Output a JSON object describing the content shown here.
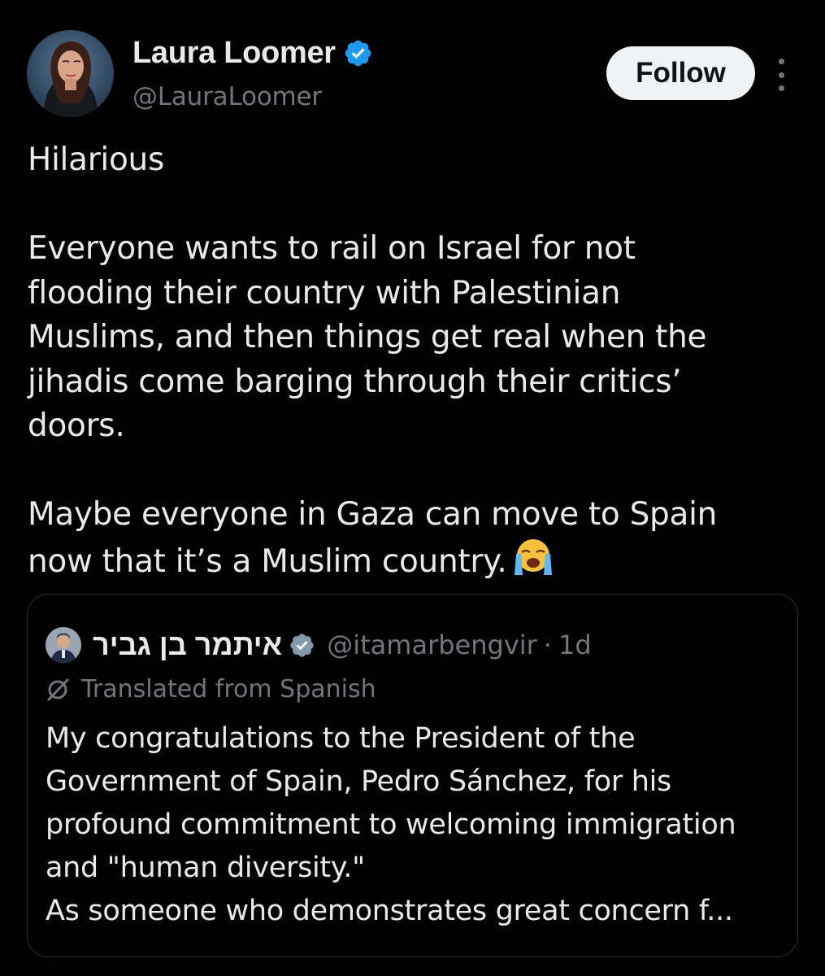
{
  "author": {
    "display_name": "Laura Loomer",
    "handle": "@LauraLoomer",
    "verified_icon": "verified-badge-icon",
    "avatar_icon": "avatar"
  },
  "actions": {
    "follow_label": "Follow",
    "more_icon": "more-options-icon"
  },
  "tweet": {
    "paragraphs": [
      "Hilarious",
      "Everyone wants to rail on Israel for not\nflooding their country with Palestinian\nMuslims, and then things get real when the\njihadis come barging through their critics’\ndoors.",
      "Maybe everyone in Gaza can move to Spain\nnow that it’s a Muslim country."
    ],
    "emoji": "loudly-crying-face-emoji"
  },
  "quoted_tweet": {
    "display_name": "איתמר בן גביר",
    "handle": "@itamarbengvir",
    "separator": "·",
    "time": "1d",
    "translated_label": "Translated from Spanish",
    "text": "My congratulations to the President of the\nGovernment of Spain, Pedro Sánchez, for his\nprofound commitment to welcoming immigration\nand \"human diversity.\"\nAs someone who demonstrates great concern f..."
  },
  "colors": {
    "background": "#000000",
    "primary_text": "#e7e9ea",
    "secondary_text": "#71767b",
    "verified_blue": "#1d9bf0",
    "border": "#2f3336",
    "follow_button_bg": "#eff3f4"
  }
}
